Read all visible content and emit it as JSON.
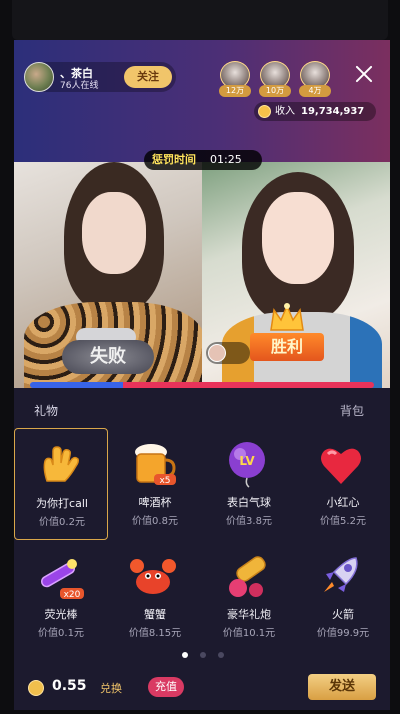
{
  "host": {
    "name": "、茶白",
    "online": "76人在线",
    "follow_label": "关注"
  },
  "ranking": [
    {
      "value": "12万"
    },
    {
      "value": "10万"
    },
    {
      "value": "4万"
    }
  ],
  "income": {
    "label": "收入",
    "value": "19,734,937"
  },
  "pk": {
    "punish_label": "惩罚时间",
    "timer": "01:25",
    "lose_label": "失败",
    "win_label": "胜利",
    "left_ratio": 0.27,
    "left_color": "#3864e8",
    "right_color": "#e8335a"
  },
  "panel": {
    "tab_gift": "礼物",
    "tab_bag": "背包",
    "gifts": [
      {
        "name": "为你打call",
        "price": "价值0.2元",
        "icon": "hand-call-icon",
        "selected": true
      },
      {
        "name": "啤酒杯",
        "price": "价值0.8元",
        "icon": "beer-mug-icon",
        "badge": "x5"
      },
      {
        "name": "表白气球",
        "price": "价值3.8元",
        "icon": "balloon-icon"
      },
      {
        "name": "小红心",
        "price": "价值5.2元",
        "icon": "red-heart-icon"
      },
      {
        "name": "荧光棒",
        "price": "价值0.1元",
        "icon": "glow-stick-icon",
        "badge": "x20"
      },
      {
        "name": "蟹蟹",
        "price": "价值8.15元",
        "icon": "crab-icon"
      },
      {
        "name": "豪华礼炮",
        "price": "价值10.1元",
        "icon": "cannon-icon"
      },
      {
        "name": "火箭",
        "price": "价值99.9元",
        "icon": "rocket-icon"
      }
    ],
    "page_count": 3,
    "active_page": 0
  },
  "bottom": {
    "balance": "0.55",
    "exchange_label": "兑换",
    "recharge_label": "充值",
    "send_label": "发送"
  }
}
